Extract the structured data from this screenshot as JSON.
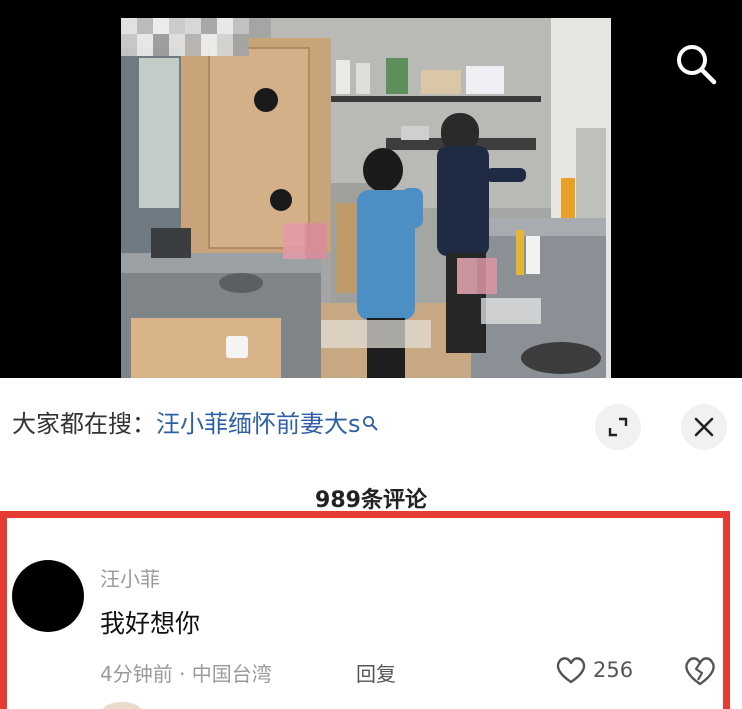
{
  "video": {
    "blurred_tag": "mosaic-overlay",
    "search_icon": "search-icon"
  },
  "search_hint": {
    "prefix": "大家都在搜：",
    "query": "汪小菲缅怀前妻大s",
    "icon": "search-icon",
    "expand_icon": "expand-icon",
    "close_icon": "close-icon"
  },
  "comments": {
    "count_label": "989条评论",
    "items": [
      {
        "username": "汪小菲",
        "text": "我好想你",
        "meta": "4分钟前 · 中国台湾",
        "reply_label": "回复",
        "likes": "256",
        "like_icon": "heart-icon",
        "dislike_icon": "broken-heart-icon"
      }
    ]
  },
  "colors": {
    "highlight_border": "#e53b33",
    "query_link": "#2f5fa5",
    "meta_gray": "#9a9a9a"
  }
}
